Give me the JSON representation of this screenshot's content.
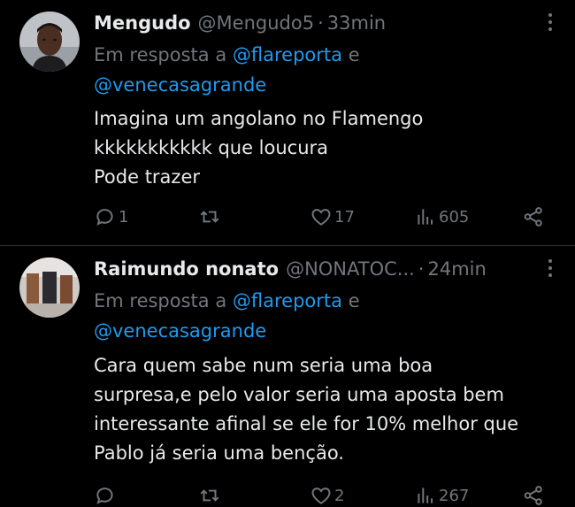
{
  "tweets": [
    {
      "name": "Mengudo",
      "handle": "@Mengudo5",
      "separator": "·",
      "time": "33min",
      "reply_prefix": "Em resposta a",
      "mention_1": "@flareporta",
      "conjunction": "e",
      "mention_2": "@venecasagrande",
      "lines": [
        "Imagina um angolano no Flamengo",
        "kkkkkkkkkkk que loucura",
        "Pode trazer"
      ],
      "replies": "1",
      "retweets": "",
      "likes": "17",
      "views": "605"
    },
    {
      "name": "Raimundo nonato",
      "handle": "@NONATOC...",
      "separator": "·",
      "time": "24min",
      "reply_prefix": "Em resposta a",
      "mention_1": "@flareporta",
      "conjunction": "e",
      "mention_2": "@venecasagrande",
      "lines": [
        "Cara quem sabe num seria uma boa",
        "surpresa,e pelo valor seria uma aposta bem",
        "interessante afinal se ele for 10% melhor que",
        "Pablo já seria uma benção."
      ],
      "replies": "",
      "retweets": "",
      "likes": "2",
      "views": "267"
    }
  ],
  "icons": {
    "reply": "reply-icon",
    "retweet": "retweet-icon",
    "like": "heart-icon",
    "views": "views-icon",
    "share": "share-icon",
    "more": "more-icon"
  },
  "colors": {
    "background": "#000000",
    "text": "#e7e9ea",
    "muted": "#71767b",
    "link": "#1d9bf0",
    "divider": "#2f3336"
  }
}
